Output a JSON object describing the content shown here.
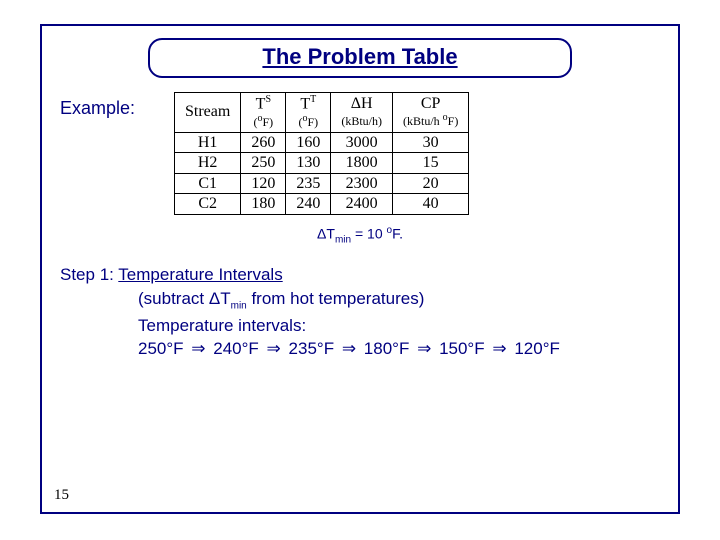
{
  "title": "The Problem Table",
  "example_label": "Example:",
  "table": {
    "headers": {
      "stream": "Stream",
      "ts_label": "T",
      "ts_sup": "S",
      "ts_unit_pre": "(",
      "ts_unit_deg": "o",
      "ts_unit_f": "F)",
      "tt_label": "T",
      "tt_sup": "T",
      "tt_unit_pre": "(",
      "tt_unit_deg": "o",
      "tt_unit_f": "F)",
      "dh_sym": "Δ",
      "dh_label": "H",
      "dh_unit": "(kBtu/h)",
      "cp_label": "CP",
      "cp_unit_pre": "(kBtu/h ",
      "cp_unit_deg": "o",
      "cp_unit_f": "F)"
    },
    "rows": [
      {
        "stream": "H1",
        "ts": "260",
        "tt": "160",
        "dh": "3000",
        "cp": "30"
      },
      {
        "stream": "H2",
        "ts": "250",
        "tt": "130",
        "dh": "1800",
        "cp": "15"
      },
      {
        "stream": "C1",
        "ts": "120",
        "tt": "235",
        "dh": "2300",
        "cp": "20"
      },
      {
        "stream": "C2",
        "ts": "180",
        "tt": "240",
        "dh": "2400",
        "cp": "40"
      }
    ]
  },
  "dtmin": {
    "delta": "Δ",
    "t": "T",
    "sub": "min",
    "eq": " = 10 ",
    "deg": "o",
    "f": "F."
  },
  "step1": {
    "label": "Step 1:  ",
    "title": "Temperature Intervals",
    "line2_a": "(subtract ",
    "line2_delta": "Δ",
    "line2_t": "T",
    "line2_sub": "min",
    "line2_b": " from hot temperatures)",
    "line3": "Temperature intervals:",
    "chain": [
      "250°F",
      "240°F",
      "235°F",
      "180°F",
      "150°F",
      "120°F"
    ],
    "arrow": "⇒"
  },
  "page_number": "15",
  "chart_data": {
    "type": "table",
    "title": "The Problem Table",
    "columns": [
      "Stream",
      "T^S (°F)",
      "T^T (°F)",
      "ΔH (kBtu/h)",
      "CP (kBtu/h °F)"
    ],
    "rows": [
      [
        "H1",
        260,
        160,
        3000,
        30
      ],
      [
        "H2",
        250,
        130,
        1800,
        15
      ],
      [
        "C1",
        120,
        235,
        2300,
        20
      ],
      [
        "C2",
        180,
        240,
        2400,
        40
      ]
    ],
    "delta_T_min_F": 10,
    "temperature_intervals_F": [
      250,
      240,
      235,
      180,
      150,
      120
    ]
  }
}
